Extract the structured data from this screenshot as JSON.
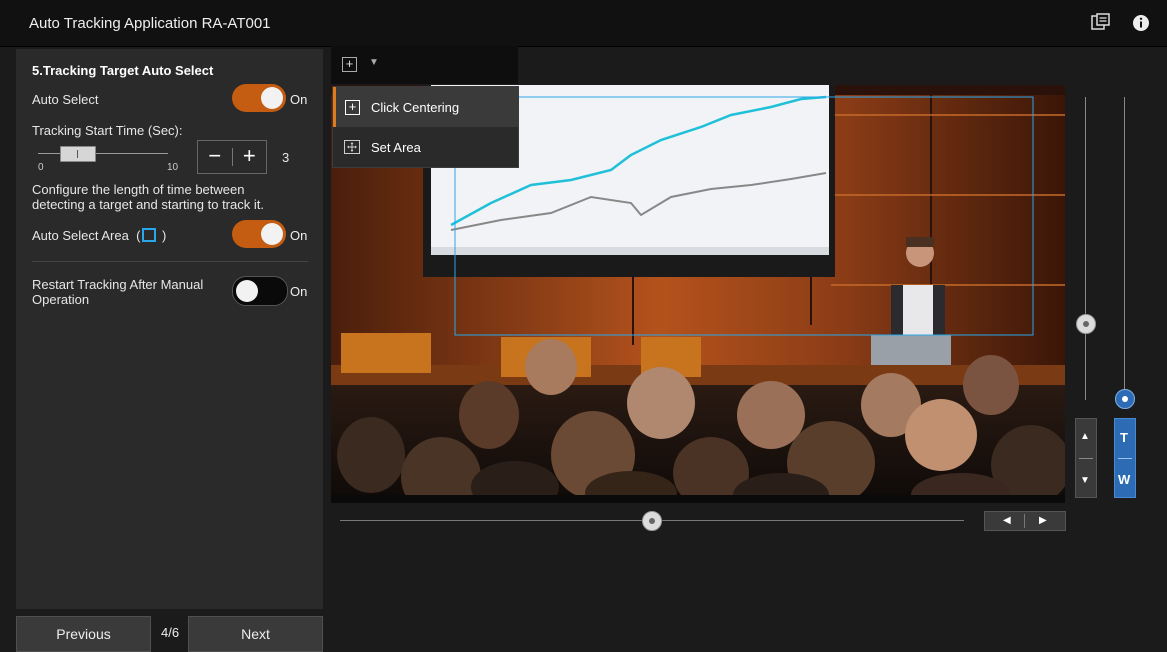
{
  "app": {
    "title": "Auto Tracking Application RA-AT001",
    "header_icons": [
      "chat-icon",
      "info-icon"
    ]
  },
  "panel": {
    "section_title": "5.Tracking Target Auto Select",
    "auto_select": {
      "label": "Auto Select",
      "state": "On"
    },
    "tracking_start": {
      "label": "Tracking Start Time (Sec):",
      "min": "0",
      "max": "10",
      "value": "3",
      "level": 0.3,
      "minus": "−",
      "plus": "+"
    },
    "description": "Configure the length of time between detecting a target and starting to track it.",
    "auto_select_area": {
      "label_pre": "Auto Select Area  (",
      "label_post": " )",
      "state": "On"
    },
    "restart_tracking": {
      "label": "Restart Tracking After Manual Operation",
      "state": "On"
    }
  },
  "footer": {
    "previous": "Previous",
    "page": "4/6",
    "next": "Next"
  },
  "mode_menu": {
    "items": [
      {
        "label": "Click Centering",
        "selected": true
      },
      {
        "label": "Set Area",
        "selected": false
      }
    ]
  },
  "ptz": {
    "zoom_tele": "T",
    "zoom_wide": "W"
  },
  "colors": {
    "accent": "#c45c12",
    "area_frame": "#2aa7e8",
    "zoom_blue": "#2d6cb4"
  }
}
